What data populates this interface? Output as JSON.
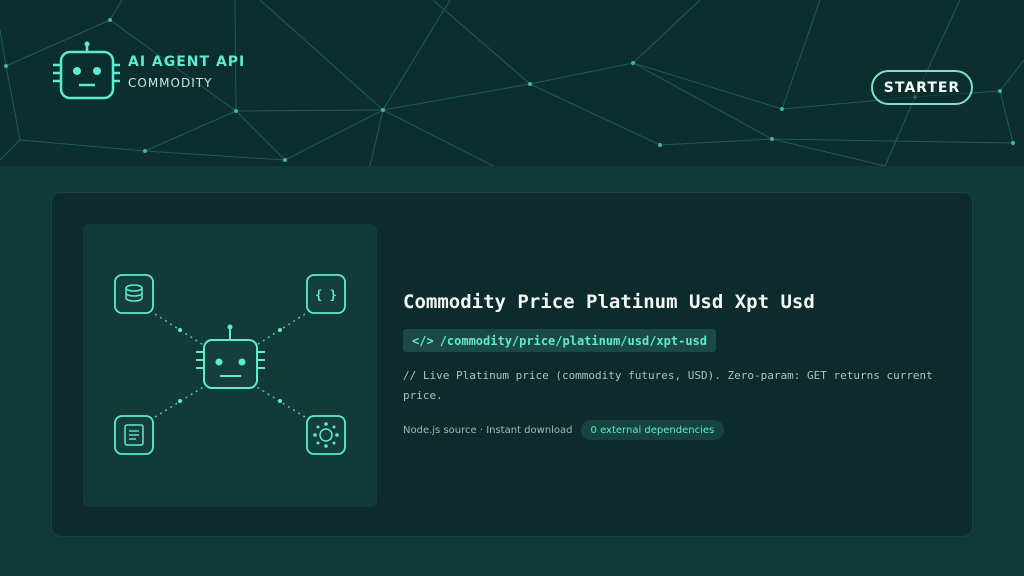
{
  "brand": {
    "title": "AI AGENT API",
    "subtitle": "COMMODITY",
    "logo_icon": "robot-icon"
  },
  "header": {
    "tier_label": "STARTER"
  },
  "product": {
    "title": "Commodity Price Platinum Usd Xpt Usd",
    "endpoint_tag": "</>",
    "endpoint": "/commodity/price/platinum/usd/xpt-usd",
    "description": "// Live Platinum price (commodity futures, USD). Zero-param: GET returns current price.",
    "meta": "Node.js source · Instant download",
    "badge": "0 external dependencies"
  },
  "illustration": {
    "icons": [
      "database-icon",
      "code-braces-icon",
      "document-icon",
      "network-hub-icon",
      "robot-icon"
    ]
  },
  "colors": {
    "accent": "#5eead4",
    "header_bg": "#0c2f2d",
    "page_bg": "#0f3a36",
    "card_bg": "#0c2b2a"
  }
}
